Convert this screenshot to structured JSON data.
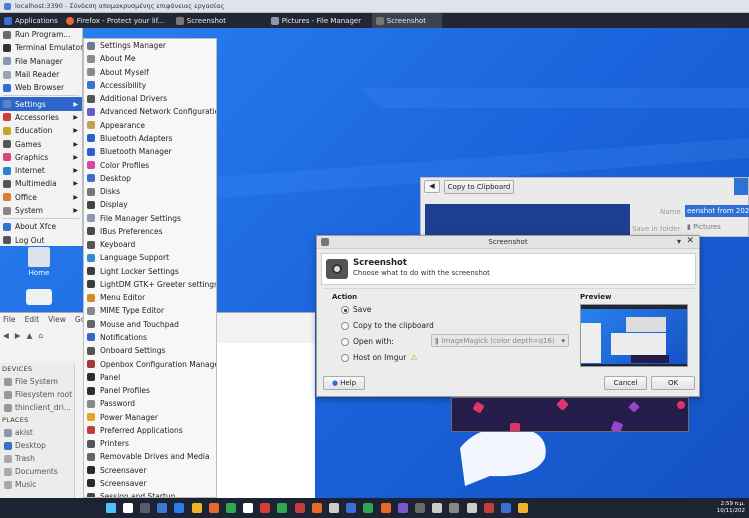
{
  "remote_title": "localhost:3390 - Σύνδεση απομακρυσμένης επιφάνειας εργασίας",
  "panel": {
    "tasks": [
      {
        "label": "Applications",
        "active": false
      },
      {
        "label": "Firefox - Protect your lif...",
        "active": false
      },
      {
        "label": "Screenshot",
        "active": false
      },
      {
        "label": "Pictures - File Manager",
        "active": false
      },
      {
        "label": "Screenshot",
        "active": true
      }
    ]
  },
  "app_menu": [
    {
      "label": "Run Program...",
      "icon": "run-icon",
      "color": "#6a6a6a"
    },
    {
      "label": "Terminal Emulator",
      "icon": "terminal-icon",
      "color": "#333333"
    },
    {
      "label": "File Manager",
      "icon": "folder-icon",
      "color": "#8a97ad"
    },
    {
      "label": "Mail Reader",
      "icon": "mail-icon",
      "color": "#9aa3b5"
    },
    {
      "label": "Web Browser",
      "icon": "globe-icon",
      "color": "#2f6fd6"
    },
    {
      "label": "Settings",
      "icon": "settings-icon",
      "color": "#5d84c6",
      "sub": true,
      "selected": true
    },
    {
      "label": "Accessories",
      "icon": "accessories-icon",
      "color": "#d13b3b",
      "sub": true
    },
    {
      "label": "Education",
      "icon": "education-icon",
      "color": "#c9a227",
      "sub": true
    },
    {
      "label": "Games",
      "icon": "games-icon",
      "color": "#555555",
      "sub": true
    },
    {
      "label": "Graphics",
      "icon": "graphics-icon",
      "color": "#d6457c",
      "sub": true
    },
    {
      "label": "Internet",
      "icon": "internet-icon",
      "color": "#2a7fd3",
      "sub": true
    },
    {
      "label": "Multimedia",
      "icon": "multimedia-icon",
      "color": "#555555",
      "sub": true
    },
    {
      "label": "Office",
      "icon": "office-icon",
      "color": "#e07b2a",
      "sub": true
    },
    {
      "label": "System",
      "icon": "system-icon",
      "color": "#888888",
      "sub": true
    },
    {
      "label": "About Xfce",
      "icon": "about-icon",
      "color": "#3273d6"
    },
    {
      "label": "Log Out",
      "icon": "logout-icon",
      "color": "#555555"
    }
  ],
  "settings_menu": [
    {
      "label": "Settings Manager",
      "color": "#6d7a8f"
    },
    {
      "label": "About Me",
      "color": "#8a8a8a"
    },
    {
      "label": "About Myself",
      "color": "#8a8a8a"
    },
    {
      "label": "Accessibility",
      "color": "#3a75d3"
    },
    {
      "label": "Additional Drivers",
      "color": "#555555"
    },
    {
      "label": "Advanced Network Configuration",
      "color": "#6a5acd"
    },
    {
      "label": "Appearance",
      "color": "#c0a35a"
    },
    {
      "label": "Bluetooth Adapters",
      "color": "#2b5fc9"
    },
    {
      "label": "Bluetooth Manager",
      "color": "#2b5fc9"
    },
    {
      "label": "Color Profiles",
      "color": "#d84aa0"
    },
    {
      "label": "Desktop",
      "color": "#3d6fc4"
    },
    {
      "label": "Disks",
      "color": "#777777"
    },
    {
      "label": "Display",
      "color": "#444444"
    },
    {
      "label": "File Manager Settings",
      "color": "#8a97ad"
    },
    {
      "label": "IBus Preferences",
      "color": "#4a4a4a"
    },
    {
      "label": "Keyboard",
      "color": "#555555"
    },
    {
      "label": "Language Support",
      "color": "#2f8bd6"
    },
    {
      "label": "Light Locker Settings",
      "color": "#3c3c3c"
    },
    {
      "label": "LightDM GTK+ Greeter settings",
      "color": "#3c3c3c"
    },
    {
      "label": "Menu Editor",
      "color": "#d08b2a"
    },
    {
      "label": "MIME Type Editor",
      "color": "#888888"
    },
    {
      "label": "Mouse and Touchpad",
      "color": "#666666"
    },
    {
      "label": "Notifications",
      "color": "#3566c9"
    },
    {
      "label": "Onboard Settings",
      "color": "#555555"
    },
    {
      "label": "Openbox Configuration Manager",
      "color": "#a23a3a"
    },
    {
      "label": "Panel",
      "color": "#2e2e2e"
    },
    {
      "label": "Panel Profiles",
      "color": "#2e2e2e"
    },
    {
      "label": "Password",
      "color": "#888888"
    },
    {
      "label": "Power Manager",
      "color": "#e0a52a"
    },
    {
      "label": "Preferred Applications",
      "color": "#c43d3d"
    },
    {
      "label": "Printers",
      "color": "#555555"
    },
    {
      "label": "Removable Drives and Media",
      "color": "#666666"
    },
    {
      "label": "Screensaver",
      "color": "#2b2b2b"
    },
    {
      "label": "Screensaver",
      "color": "#2b2b2b"
    },
    {
      "label": "Session and Startup",
      "color": "#444444"
    }
  ],
  "desktop_icon_label": "Home",
  "file_manager": {
    "menu": [
      "File",
      "Edit",
      "View",
      "Go"
    ],
    "devices_header": "DEVICES",
    "devices": [
      "File System",
      "Filesystem root",
      "thinclient_dri..."
    ],
    "places_header": "PLACES",
    "places": [
      "akist",
      "Desktop",
      "Trash",
      "Documents",
      "Music"
    ]
  },
  "bg_window": {
    "copy_button": "Copy to Clipboard",
    "name_label": "Name",
    "name_value": "eenshot from 202",
    "save_label": "Save in folder",
    "folder_value": "Pictures"
  },
  "dialog": {
    "title": "Screenshot",
    "heading": "Screenshot",
    "subheading": "Choose what to do with the screenshot",
    "action_label": "Action",
    "options": [
      {
        "label": "Save",
        "selected": true
      },
      {
        "label": "Copy to the clipboard",
        "selected": false
      },
      {
        "label": "Open with:",
        "selected": false
      },
      {
        "label": "Host on Imgur",
        "selected": false
      }
    ],
    "open_with_value": "ImageMagick (color depth=q16)",
    "preview_label": "Preview",
    "help": "Help",
    "cancel": "Cancel",
    "ok": "OK"
  },
  "taskbar": {
    "time": "2:59 π.μ.",
    "date": "10/11/202"
  }
}
